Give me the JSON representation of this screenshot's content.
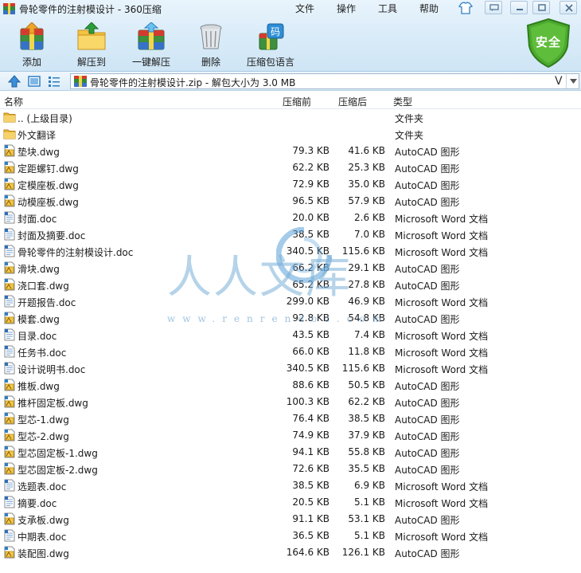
{
  "title": "骨轮零件的注射模设计 - 360压缩",
  "menu": [
    "文件",
    "操作",
    "工具",
    "帮助"
  ],
  "toolbar": [
    {
      "label": "添加",
      "icon": "add-archive-icon"
    },
    {
      "label": "解压到",
      "icon": "extract-to-icon"
    },
    {
      "label": "一键解压",
      "icon": "one-click-extract-icon"
    },
    {
      "label": "删除",
      "icon": "delete-trash-icon"
    },
    {
      "label": "压缩包语言",
      "icon": "archive-language-icon",
      "badge": "码"
    }
  ],
  "security": {
    "label": "安全"
  },
  "address": {
    "text": "骨轮零件的注射模设计.zip - 解包大小为 3.0 MB",
    "v_mark": "V"
  },
  "columns": {
    "name": "名称",
    "packed": "压缩前",
    "unpacked": "压缩后",
    "type": "类型"
  },
  "files": [
    {
      "name": ".. (上级目录)",
      "packed": "",
      "unpacked": "",
      "type": "文件夹",
      "kind": "folder"
    },
    {
      "name": "外文翻译",
      "packed": "",
      "unpacked": "",
      "type": "文件夹",
      "kind": "folder"
    },
    {
      "name": "垫块.dwg",
      "packed": "79.3 KB",
      "unpacked": "41.6 KB",
      "type": "AutoCAD 图形",
      "kind": "dwg"
    },
    {
      "name": "定距螺钉.dwg",
      "packed": "62.2 KB",
      "unpacked": "25.3 KB",
      "type": "AutoCAD 图形",
      "kind": "dwg"
    },
    {
      "name": "定模座板.dwg",
      "packed": "72.9 KB",
      "unpacked": "35.0 KB",
      "type": "AutoCAD 图形",
      "kind": "dwg"
    },
    {
      "name": "动模座板.dwg",
      "packed": "96.5 KB",
      "unpacked": "57.9 KB",
      "type": "AutoCAD 图形",
      "kind": "dwg"
    },
    {
      "name": "封面.doc",
      "packed": "20.0 KB",
      "unpacked": "2.6 KB",
      "type": "Microsoft Word 文档",
      "kind": "doc"
    },
    {
      "name": "封面及摘要.doc",
      "packed": "38.5 KB",
      "unpacked": "7.0 KB",
      "type": "Microsoft Word 文档",
      "kind": "doc"
    },
    {
      "name": "骨轮零件的注射模设计.doc",
      "packed": "340.5 KB",
      "unpacked": "115.6 KB",
      "type": "Microsoft Word 文档",
      "kind": "doc"
    },
    {
      "name": "滑块.dwg",
      "packed": "66.2 KB",
      "unpacked": "29.1 KB",
      "type": "AutoCAD 图形",
      "kind": "dwg"
    },
    {
      "name": "浇口套.dwg",
      "packed": "65.2 KB",
      "unpacked": "27.8 KB",
      "type": "AutoCAD 图形",
      "kind": "dwg"
    },
    {
      "name": "开题报告.doc",
      "packed": "299.0 KB",
      "unpacked": "46.9 KB",
      "type": "Microsoft Word 文档",
      "kind": "doc"
    },
    {
      "name": "模套.dwg",
      "packed": "92.8 KB",
      "unpacked": "54.8 KB",
      "type": "AutoCAD 图形",
      "kind": "dwg"
    },
    {
      "name": "目录.doc",
      "packed": "43.5 KB",
      "unpacked": "7.4 KB",
      "type": "Microsoft Word 文档",
      "kind": "doc"
    },
    {
      "name": "任务书.doc",
      "packed": "66.0 KB",
      "unpacked": "11.8 KB",
      "type": "Microsoft Word 文档",
      "kind": "doc"
    },
    {
      "name": "设计说明书.doc",
      "packed": "340.5 KB",
      "unpacked": "115.6 KB",
      "type": "Microsoft Word 文档",
      "kind": "doc"
    },
    {
      "name": "推板.dwg",
      "packed": "88.6 KB",
      "unpacked": "50.5 KB",
      "type": "AutoCAD 图形",
      "kind": "dwg"
    },
    {
      "name": "推杆固定板.dwg",
      "packed": "100.3 KB",
      "unpacked": "62.2 KB",
      "type": "AutoCAD 图形",
      "kind": "dwg"
    },
    {
      "name": "型芯-1.dwg",
      "packed": "76.4 KB",
      "unpacked": "38.5 KB",
      "type": "AutoCAD 图形",
      "kind": "dwg"
    },
    {
      "name": "型芯-2.dwg",
      "packed": "74.9 KB",
      "unpacked": "37.9 KB",
      "type": "AutoCAD 图形",
      "kind": "dwg"
    },
    {
      "name": "型芯固定板-1.dwg",
      "packed": "94.1 KB",
      "unpacked": "55.8 KB",
      "type": "AutoCAD 图形",
      "kind": "dwg"
    },
    {
      "name": "型芯固定板-2.dwg",
      "packed": "72.6 KB",
      "unpacked": "35.5 KB",
      "type": "AutoCAD 图形",
      "kind": "dwg"
    },
    {
      "name": "选题表.doc",
      "packed": "38.5 KB",
      "unpacked": "6.9 KB",
      "type": "Microsoft Word 文档",
      "kind": "doc"
    },
    {
      "name": "摘要.doc",
      "packed": "20.5 KB",
      "unpacked": "5.1 KB",
      "type": "Microsoft Word 文档",
      "kind": "doc"
    },
    {
      "name": "支承板.dwg",
      "packed": "91.1 KB",
      "unpacked": "53.1 KB",
      "type": "AutoCAD 图形",
      "kind": "dwg"
    },
    {
      "name": "中期表.doc",
      "packed": "36.5 KB",
      "unpacked": "5.1 KB",
      "type": "Microsoft Word 文档",
      "kind": "doc"
    },
    {
      "name": "装配图.dwg",
      "packed": "164.6 KB",
      "unpacked": "126.1 KB",
      "type": "AutoCAD 图形",
      "kind": "dwg"
    }
  ],
  "watermark": {
    "text": "人人文库",
    "url": "www.renrendoc.com"
  },
  "colors": {
    "accent": "#2f7fc4",
    "shield": "#4caa2e",
    "folder": "#f1c24b"
  }
}
